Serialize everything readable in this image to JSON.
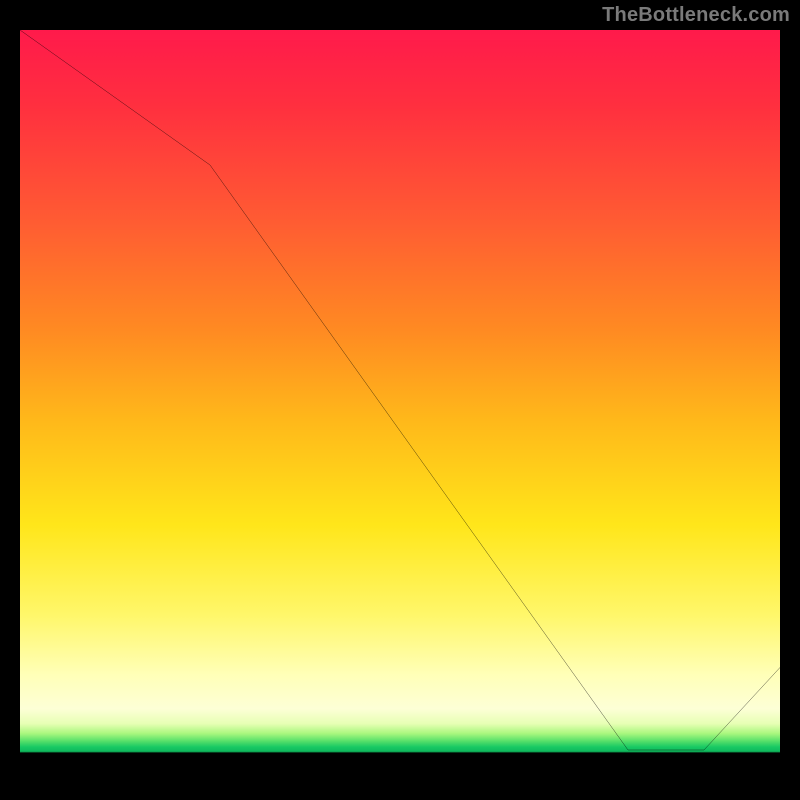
{
  "attribution": "TheBottleneck.com",
  "chart_data": {
    "type": "line",
    "title": "",
    "xlabel": "",
    "ylabel": "",
    "xlim": [
      0,
      100
    ],
    "ylim": [
      0,
      100
    ],
    "grid": false,
    "legend": false,
    "background": "red-to-green vertical gradient (high=red near top, low=green near bottom)",
    "x": [
      0,
      25,
      80,
      90,
      100
    ],
    "values": [
      100,
      82,
      4,
      4,
      15
    ],
    "annotations": [
      {
        "x": 82,
        "y": 5.5,
        "text": "",
        "color": "#b22020"
      }
    ],
    "notes": "Curve: starts at top-left, gentle down-slope to ~x=25 (slight knee), then steep near-linear descent to a flat minimum around x≈80–90 near the green band, then rises toward bottom-right. Axis tick labels are not visible; values are read proportionally from the 0–100 frame."
  },
  "tiny_label_text": ""
}
